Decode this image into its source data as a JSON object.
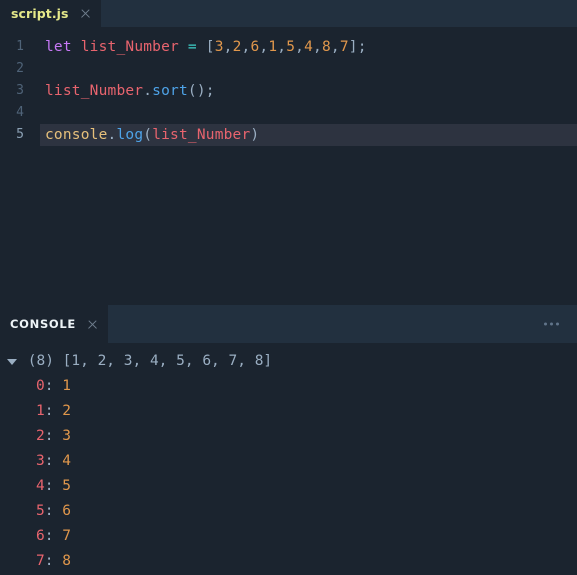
{
  "editor": {
    "tab": {
      "title": "script.js",
      "close_icon": "close-icon"
    },
    "active_line": 5,
    "lines": [
      {
        "number": "1",
        "tokens": [
          {
            "text": "let",
            "type": "kw"
          },
          {
            "text": " ",
            "type": "plain"
          },
          {
            "text": "list_Number",
            "type": "var"
          },
          {
            "text": " ",
            "type": "plain"
          },
          {
            "text": "=",
            "type": "op"
          },
          {
            "text": " ",
            "type": "plain"
          },
          {
            "text": "[",
            "type": "punct"
          },
          {
            "text": "3",
            "type": "num"
          },
          {
            "text": ",",
            "type": "punct"
          },
          {
            "text": "2",
            "type": "num"
          },
          {
            "text": ",",
            "type": "punct"
          },
          {
            "text": "6",
            "type": "num"
          },
          {
            "text": ",",
            "type": "punct"
          },
          {
            "text": "1",
            "type": "num"
          },
          {
            "text": ",",
            "type": "punct"
          },
          {
            "text": "5",
            "type": "num"
          },
          {
            "text": ",",
            "type": "punct"
          },
          {
            "text": "4",
            "type": "num"
          },
          {
            "text": ",",
            "type": "punct"
          },
          {
            "text": "8",
            "type": "num"
          },
          {
            "text": ",",
            "type": "punct"
          },
          {
            "text": "7",
            "type": "num"
          },
          {
            "text": "]",
            "type": "punct"
          },
          {
            "text": ";",
            "type": "punct"
          }
        ]
      },
      {
        "number": "2",
        "tokens": []
      },
      {
        "number": "3",
        "tokens": [
          {
            "text": "list_Number",
            "type": "var"
          },
          {
            "text": ".",
            "type": "punct"
          },
          {
            "text": "sort",
            "type": "fn"
          },
          {
            "text": "(",
            "type": "punct"
          },
          {
            "text": ")",
            "type": "punct"
          },
          {
            "text": ";",
            "type": "punct"
          }
        ]
      },
      {
        "number": "4",
        "tokens": []
      },
      {
        "number": "5",
        "tokens": [
          {
            "text": "console",
            "type": "obj"
          },
          {
            "text": ".",
            "type": "punct"
          },
          {
            "text": "log",
            "type": "fn"
          },
          {
            "text": "(",
            "type": "punct"
          },
          {
            "text": "list_Number",
            "type": "var"
          },
          {
            "text": ")",
            "type": "punct"
          }
        ]
      }
    ]
  },
  "console": {
    "tab": {
      "title": "CONSOLE",
      "close_icon": "close-icon"
    },
    "more_icon": "more-options-icon",
    "output": {
      "disclosure_icon": "triangle-down-icon",
      "expanded": true,
      "summary": "(8) [1, 2, 3, 4, 5, 6, 7, 8]",
      "count": 8,
      "entries": [
        {
          "index": "0",
          "value": "1"
        },
        {
          "index": "1",
          "value": "2"
        },
        {
          "index": "2",
          "value": "3"
        },
        {
          "index": "3",
          "value": "4"
        },
        {
          "index": "4",
          "value": "5"
        },
        {
          "index": "5",
          "value": "6"
        },
        {
          "index": "6",
          "value": "7"
        },
        {
          "index": "7",
          "value": "8"
        }
      ]
    }
  },
  "theme": {
    "editor_bg": "#1b242f",
    "tabbar_bg": "#22303f",
    "active_line_bg": "#2d3340",
    "keyword": "#c678f5",
    "variable": "#e8646e",
    "operator": "#3fd0c9",
    "number": "#e0974c",
    "function": "#4ea3e8",
    "object": "#e6c07b",
    "punctuation": "#9aaec2",
    "tab_title": "#e5e98a",
    "line_number": "#4f6378"
  }
}
